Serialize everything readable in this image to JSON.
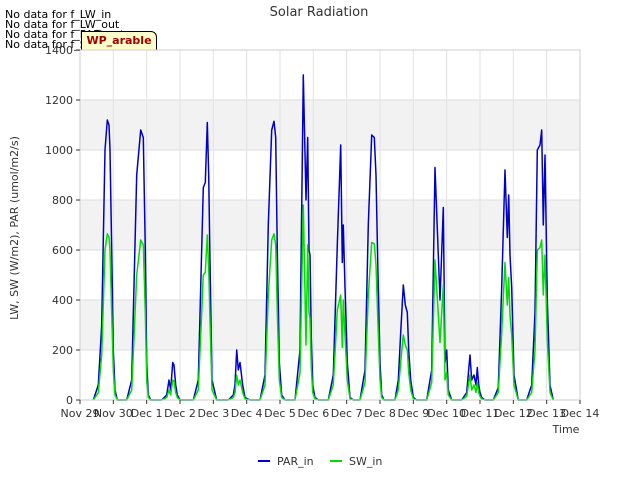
{
  "notices": [
    "No data for f_LW_in",
    "No data for f_LW_out",
    "No data for f_PAR_out",
    "No data for f_SW_out"
  ],
  "badge": "WP_arable",
  "chart_data": {
    "type": "line",
    "title": "Solar Radiation",
    "xlabel": "Time",
    "ylabel": "LW, SW (W/m2), PAR (umol/m2/s)",
    "x_ticks": [
      "Nov 29",
      "Nov 30",
      "Dec 1",
      "Dec 2",
      "Dec 3",
      "Dec 4",
      "Dec 5",
      "Dec 6",
      "Dec 7",
      "Dec 8",
      "Dec 9",
      "Dec 10",
      "Dec 11",
      "Dec 12",
      "Dec 13",
      "Dec 14"
    ],
    "xlim": [
      "Nov 29",
      "Dec 14"
    ],
    "ylim": [
      0,
      1400
    ],
    "y_ticks": [
      0,
      200,
      400,
      600,
      800,
      1000,
      1200,
      1400
    ],
    "grid": true,
    "legend_position": "bottom-center",
    "series": [
      {
        "name": "PAR_in",
        "color": "#0000cc",
        "x": [
          0.4,
          0.55,
          0.65,
          0.75,
          0.82,
          0.87,
          0.9,
          0.95,
          1.0,
          1.05,
          1.12,
          1.2,
          1.4,
          1.55,
          1.7,
          1.82,
          1.9,
          1.96,
          2.0,
          2.05,
          2.12,
          2.45,
          2.6,
          2.67,
          2.72,
          2.78,
          2.82,
          2.87,
          2.92,
          3.0,
          3.1,
          3.4,
          3.55,
          3.7,
          3.76,
          3.82,
          3.86,
          3.9,
          3.96,
          4.1,
          4.2,
          4.45,
          4.6,
          4.65,
          4.7,
          4.75,
          4.8,
          4.88,
          4.95,
          5.1,
          5.4,
          5.55,
          5.65,
          5.75,
          5.82,
          5.87,
          5.92,
          5.98,
          6.05,
          6.15,
          6.45,
          6.6,
          6.7,
          6.78,
          6.83,
          6.87,
          6.9,
          6.94,
          6.98,
          7.05,
          7.15,
          7.45,
          7.6,
          7.72,
          7.82,
          7.87,
          7.9,
          7.95,
          8.02,
          8.1,
          8.2,
          8.4,
          8.55,
          8.65,
          8.75,
          8.83,
          8.88,
          8.94,
          9.0,
          9.05,
          9.12,
          9.2,
          9.45,
          9.55,
          9.62,
          9.7,
          9.76,
          9.82,
          9.86,
          9.92,
          10.0,
          10.1,
          10.4,
          10.55,
          10.65,
          10.8,
          10.9,
          10.95,
          11.0,
          11.05,
          11.15,
          11.45,
          11.6,
          11.7,
          11.75,
          11.82,
          11.88,
          11.92,
          11.96,
          12.0,
          12.05,
          12.15,
          12.4,
          12.55,
          12.65,
          12.75,
          12.82,
          12.86,
          12.9,
          12.95,
          13.02,
          13.15,
          13.4,
          13.55,
          13.65,
          13.72,
          13.8,
          13.85,
          13.9,
          13.95,
          14.02,
          14.1,
          14.2
        ],
        "y": [
          0,
          60,
          300,
          1000,
          1120,
          1100,
          1000,
          600,
          200,
          40,
          0,
          0,
          0,
          80,
          900,
          1080,
          1050,
          600,
          150,
          20,
          0,
          0,
          20,
          80,
          40,
          150,
          140,
          60,
          20,
          0,
          0,
          0,
          80,
          850,
          870,
          1110,
          900,
          550,
          80,
          0,
          0,
          0,
          20,
          60,
          200,
          120,
          150,
          60,
          10,
          0,
          0,
          100,
          700,
          1080,
          1115,
          1050,
          600,
          150,
          20,
          0,
          0,
          200,
          1300,
          800,
          1050,
          600,
          580,
          250,
          60,
          10,
          0,
          0,
          100,
          620,
          1020,
          550,
          700,
          450,
          150,
          10,
          0,
          0,
          120,
          700,
          1060,
          1050,
          900,
          500,
          150,
          20,
          0,
          0,
          0,
          80,
          270,
          460,
          380,
          350,
          200,
          80,
          10,
          0,
          0,
          120,
          930,
          400,
          770,
          150,
          200,
          40,
          0,
          0,
          30,
          180,
          80,
          100,
          60,
          130,
          60,
          30,
          10,
          0,
          0,
          50,
          450,
          920,
          650,
          820,
          580,
          450,
          100,
          0,
          0,
          60,
          350,
          1000,
          1020,
          1080,
          700,
          980,
          400,
          60,
          0
        ]
      },
      {
        "name": "SW_in",
        "color": "#00dd00",
        "x": [
          0.4,
          0.55,
          0.65,
          0.75,
          0.82,
          0.87,
          0.9,
          0.95,
          1.0,
          1.05,
          1.12,
          1.2,
          1.4,
          1.55,
          1.7,
          1.82,
          1.9,
          1.96,
          2.0,
          2.05,
          2.12,
          2.45,
          2.6,
          2.67,
          2.72,
          2.78,
          2.82,
          2.87,
          2.92,
          3.0,
          3.1,
          3.4,
          3.55,
          3.7,
          3.76,
          3.82,
          3.86,
          3.9,
          3.96,
          4.1,
          4.2,
          4.45,
          4.6,
          4.65,
          4.7,
          4.75,
          4.8,
          4.88,
          4.95,
          5.1,
          5.4,
          5.55,
          5.65,
          5.75,
          5.82,
          5.87,
          5.92,
          5.98,
          6.05,
          6.15,
          6.45,
          6.6,
          6.7,
          6.78,
          6.83,
          6.87,
          6.9,
          6.94,
          6.98,
          7.05,
          7.15,
          7.45,
          7.6,
          7.72,
          7.82,
          7.87,
          7.9,
          7.95,
          8.02,
          8.1,
          8.2,
          8.4,
          8.55,
          8.65,
          8.75,
          8.83,
          8.88,
          8.94,
          9.0,
          9.05,
          9.12,
          9.2,
          9.45,
          9.55,
          9.62,
          9.7,
          9.76,
          9.82,
          9.86,
          9.92,
          10.0,
          10.1,
          10.4,
          10.55,
          10.65,
          10.8,
          10.9,
          10.95,
          11.0,
          11.05,
          11.15,
          11.45,
          11.6,
          11.7,
          11.75,
          11.82,
          11.88,
          11.92,
          11.96,
          12.0,
          12.05,
          12.15,
          12.4,
          12.55,
          12.65,
          12.75,
          12.82,
          12.86,
          12.9,
          12.95,
          13.02,
          13.15,
          13.4,
          13.55,
          13.65,
          13.72,
          13.8,
          13.85,
          13.9,
          13.95,
          14.02,
          14.1,
          14.2
        ],
        "y": [
          0,
          30,
          180,
          600,
          665,
          650,
          600,
          350,
          120,
          20,
          0,
          0,
          0,
          40,
          500,
          640,
          620,
          350,
          80,
          10,
          0,
          0,
          10,
          40,
          20,
          80,
          75,
          30,
          10,
          0,
          0,
          0,
          40,
          500,
          510,
          660,
          530,
          320,
          40,
          0,
          0,
          0,
          10,
          30,
          100,
          60,
          80,
          30,
          5,
          0,
          0,
          60,
          420,
          640,
          665,
          620,
          350,
          80,
          10,
          0,
          0,
          110,
          780,
          220,
          620,
          350,
          330,
          130,
          30,
          5,
          0,
          0,
          60,
          360,
          420,
          210,
          400,
          260,
          80,
          5,
          0,
          0,
          70,
          420,
          630,
          625,
          540,
          300,
          80,
          10,
          0,
          0,
          0,
          40,
          150,
          260,
          220,
          200,
          110,
          40,
          5,
          0,
          0,
          70,
          560,
          230,
          460,
          80,
          110,
          20,
          0,
          0,
          15,
          100,
          40,
          60,
          30,
          70,
          30,
          15,
          5,
          0,
          0,
          30,
          270,
          550,
          380,
          490,
          340,
          260,
          60,
          0,
          0,
          30,
          200,
          600,
          610,
          640,
          420,
          580,
          240,
          30,
          0
        ]
      }
    ]
  }
}
